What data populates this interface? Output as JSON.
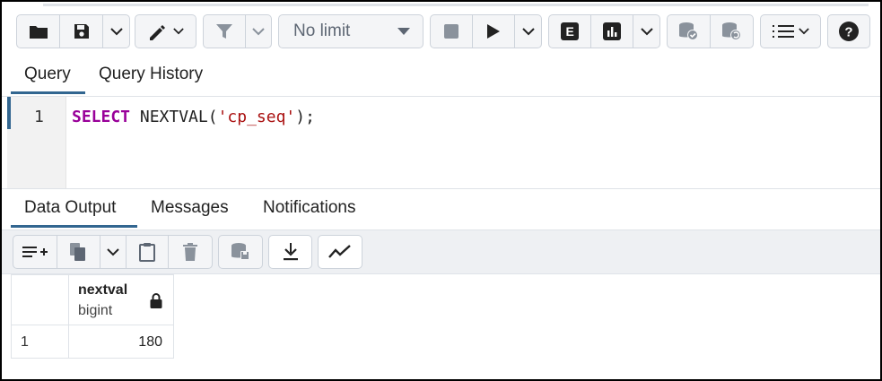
{
  "toolbar": {
    "limit_value": "No limit",
    "explain_label": "E"
  },
  "query_tabs": [
    {
      "label": "Query",
      "active": true
    },
    {
      "label": "Query History",
      "active": false
    }
  ],
  "editor": {
    "line_number": "1",
    "code": {
      "keyword": "SELECT",
      "function": " NEXTVAL(",
      "string": "'cp_seq'",
      "tail": ");"
    }
  },
  "output_tabs": [
    {
      "label": "Data Output",
      "active": true
    },
    {
      "label": "Messages",
      "active": false
    },
    {
      "label": "Notifications",
      "active": false
    }
  ],
  "results": {
    "columns": [
      {
        "name": "nextval",
        "type": "bigint",
        "icon": "lock-icon"
      }
    ],
    "rows": [
      {
        "row_number": "1",
        "values": [
          "180"
        ]
      }
    ]
  },
  "colors": {
    "accent": "#326690",
    "keyword": "#990099",
    "string": "#aa1111"
  }
}
